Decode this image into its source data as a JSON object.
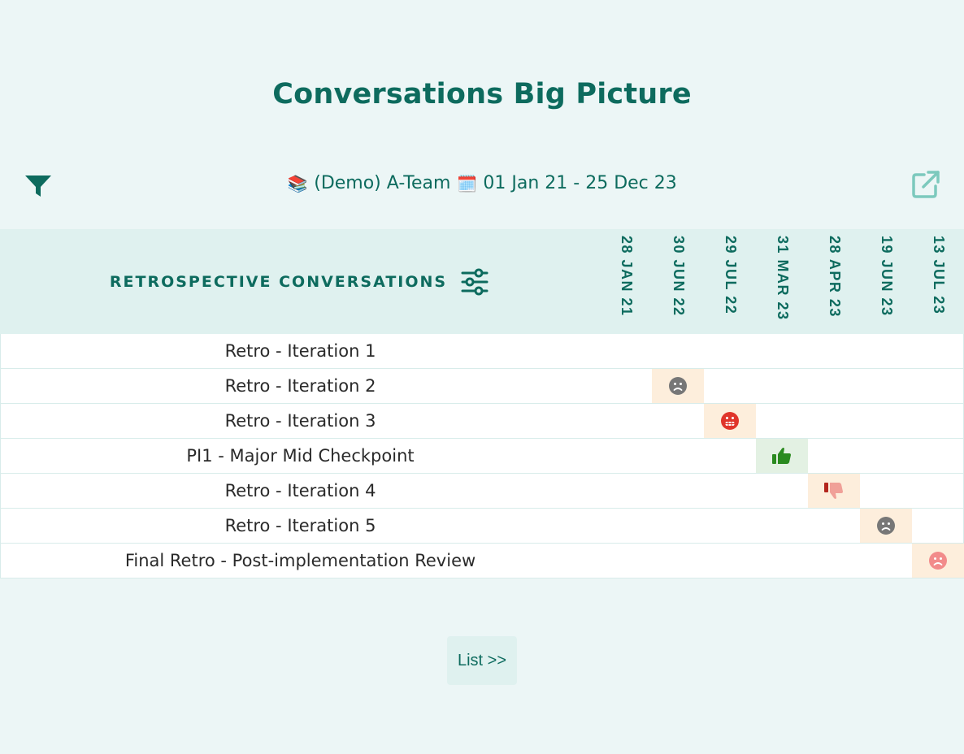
{
  "page": {
    "title": "Conversations Big Picture"
  },
  "toolbar": {
    "team_emoji": "📚",
    "team": "(Demo) A-Team",
    "calendar_emoji": "🗓️",
    "date_range": "01 Jan 21 - 25 Dec 23"
  },
  "table": {
    "column_title": "RETROSPECTIVE CONVERSATIONS",
    "dates": [
      "28 JAN 21",
      "30 JUN 22",
      "29 JUL 22",
      "31 MAR 23",
      "28 APR 23",
      "19 JUN 23",
      "13 JUL 23"
    ],
    "rows": [
      {
        "name": "Retro - Iteration 1",
        "icon": ""
      },
      {
        "name": "Retro - Iteration 2",
        "icon": "frown-face-grey-icon"
      },
      {
        "name": "Retro - Iteration 3",
        "icon": "grimace-face-red-icon"
      },
      {
        "name": "PI1 - Major Mid Checkpoint",
        "icon": "thumbs-up-green-icon"
      },
      {
        "name": "Retro - Iteration 4",
        "icon": "thumbs-down-red-icon"
      },
      {
        "name": "Retro - Iteration 5",
        "icon": "frown-face-grey-icon"
      },
      {
        "name": "Final Retro - Post-implementation Review",
        "icon": "frown-face-pink-icon"
      }
    ]
  },
  "footer": {
    "list_label": "List >>"
  },
  "colors": {
    "background": "#ecf6f6",
    "accent": "#0d6b5e",
    "header_bg": "#dff1ef",
    "warn_cell": "#fdeedc",
    "good_cell": "#e3f1e3"
  }
}
